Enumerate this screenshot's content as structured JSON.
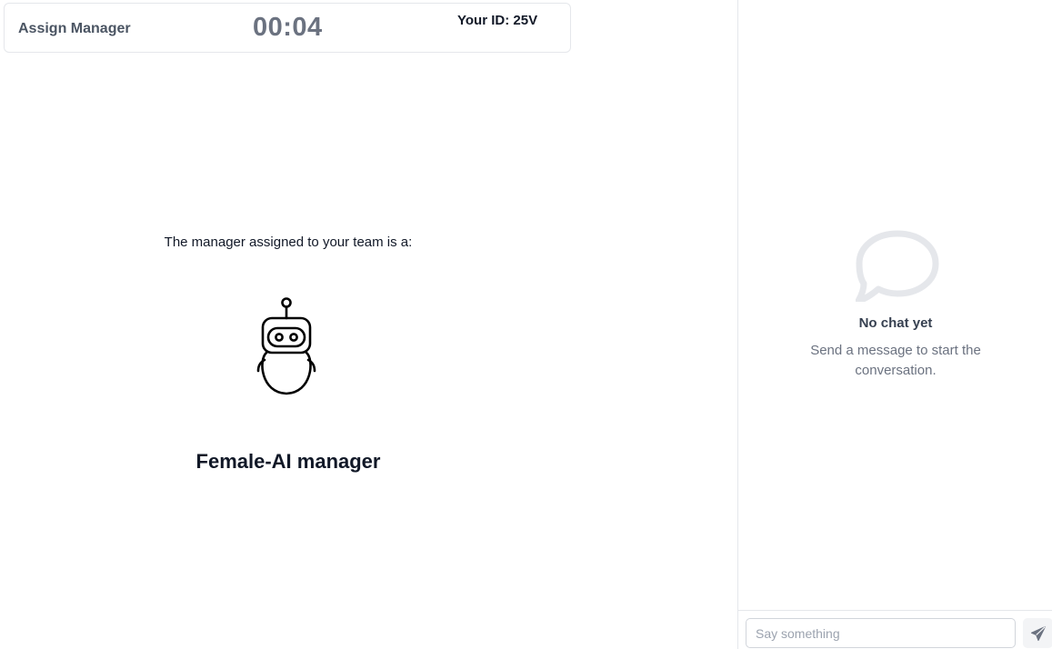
{
  "header": {
    "stage_title": "Assign Manager",
    "timer": "00:04",
    "user_id": "Your ID: 25V"
  },
  "main": {
    "assignment_text": "The manager assigned to your team is a:",
    "manager_icon": "robot-icon",
    "manager_type": "Female-AI manager"
  },
  "chat": {
    "empty_icon": "chat-bubble-icon",
    "empty_title": "No chat yet",
    "empty_subtitle": "Send a message to start the conversation.",
    "input_placeholder": "Say something",
    "input_value": "",
    "send_icon": "paper-plane-icon"
  },
  "colors": {
    "muted_text": "#6b7280",
    "border": "#e5e7eb",
    "icon_gray": "#e5e7eb",
    "send_icon": "#6b7280"
  }
}
